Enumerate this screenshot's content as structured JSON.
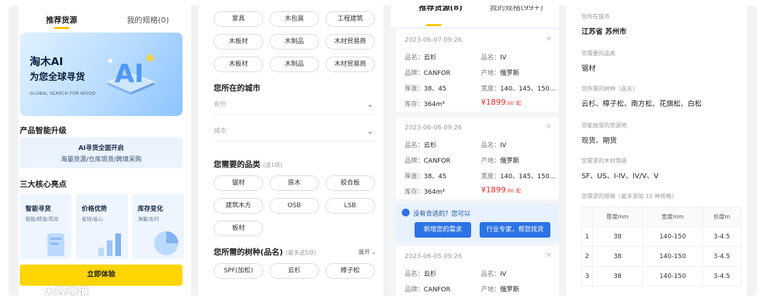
{
  "panel1": {
    "tabs": [
      "推荐货源",
      "我的规格(0)"
    ],
    "banner": {
      "title": "淘木AI",
      "subtitle": "为您全球寻货",
      "en": "GLOBAL SEARCH FOR WOOD",
      "ai_text": "AI"
    },
    "section_upgrade": "产品智能升级",
    "ai_card": {
      "title": "AI寻货全面开启",
      "desc": "海量货源/仓库现货/跨境采购"
    },
    "section_highlights": "三大核心亮点",
    "highlights": [
      {
        "title": "智能寻货",
        "desc": "智能/精准/高效"
      },
      {
        "title": "价格优势",
        "desc": "省钱/省心"
      },
      {
        "title": "库存变化",
        "desc": "海量/实时"
      }
    ],
    "cta": "立即体验"
  },
  "panel2": {
    "top_chips": [
      "家具",
      "木包装",
      "工程建筑",
      "木板材",
      "木制品",
      "木材贸易商",
      "木板材",
      "木制品",
      "木材贸易商"
    ],
    "city_title": "您所在的城市",
    "province_placeholder": "省份",
    "city_placeholder": "城市",
    "category_title": "您需要的品类",
    "category_hint": "(选1项)",
    "categories": [
      "锯材",
      "原木",
      "胶合板",
      "建筑木方",
      "OSB",
      "LSB",
      "板材"
    ],
    "species_title": "您所需的树种(品名)",
    "species_hint": "(最多选5项)",
    "expand": "展开",
    "species": [
      "SPF(加松)",
      "云杉",
      "樟子松"
    ]
  },
  "panel3": {
    "tabs": [
      "推荐货源(8)",
      "我的规格(99+)"
    ],
    "labels": {
      "name": "品名：",
      "grade": "品名：",
      "brand": "品牌：",
      "origin": "产地：",
      "thick": "厚度：",
      "width": "宽度：",
      "stock": "库存："
    },
    "cards": [
      {
        "date": "2023-06-07 09:26",
        "name": "云杉",
        "grade": "IV",
        "brand": "CANFOR",
        "origin": "俄罗斯",
        "thick": "38、45",
        "width": "140、145、150...",
        "stock": "364m³",
        "price_int": "¥1899",
        "price_dec": ".00",
        "price_unit": "起"
      },
      {
        "date": "2023-06-06 09:26",
        "name": "云杉",
        "grade": "IV",
        "brand": "CANFOR",
        "origin": "俄罗斯",
        "thick": "38、45",
        "width": "140、145、150...",
        "stock": "364m³",
        "price_int": "¥1899",
        "price_dec": ".00",
        "price_unit": "起"
      },
      {
        "date": "2023-06-05 09:26",
        "name": "云杉",
        "grade": "IV",
        "brand": "CANFOR",
        "origin": "俄罗斯"
      }
    ],
    "help": {
      "question": "没有合适的？您可以",
      "btn_new": "新增您的需求",
      "btn_expert": "行业专家，帮您找货"
    }
  },
  "panel4": {
    "city_label": "您所在城市",
    "city_value": "江苏省 苏州市",
    "cat_label": "您需要的品类",
    "cat_value": "锯材",
    "species_label": "您所需的树种（品名）",
    "species_value": "云杉、樟子松、南方松、花旗松、白松",
    "source_label": "您能接受的货源地",
    "source_value": "现货、期货",
    "grade_label": "您需求的木材等级",
    "grade_value": "SF、US、I-IV、IV/V、V",
    "spec_label": "您需求的规格（最多添加 10 种规格）",
    "table_headers": [
      "",
      "厚度mm",
      "宽度mm",
      "长度m"
    ],
    "rows": [
      [
        "1",
        "38",
        "140-150",
        "3-4.5"
      ],
      [
        "2",
        "38",
        "140-150",
        "3-4.5"
      ],
      [
        "3",
        "38",
        "140-150",
        "3-4.5"
      ]
    ]
  },
  "watermark": "大数跨境",
  "colors": {
    "accent_yellow": "#ffd500",
    "price_red": "#e8302c",
    "blue": "#2d73e6"
  }
}
